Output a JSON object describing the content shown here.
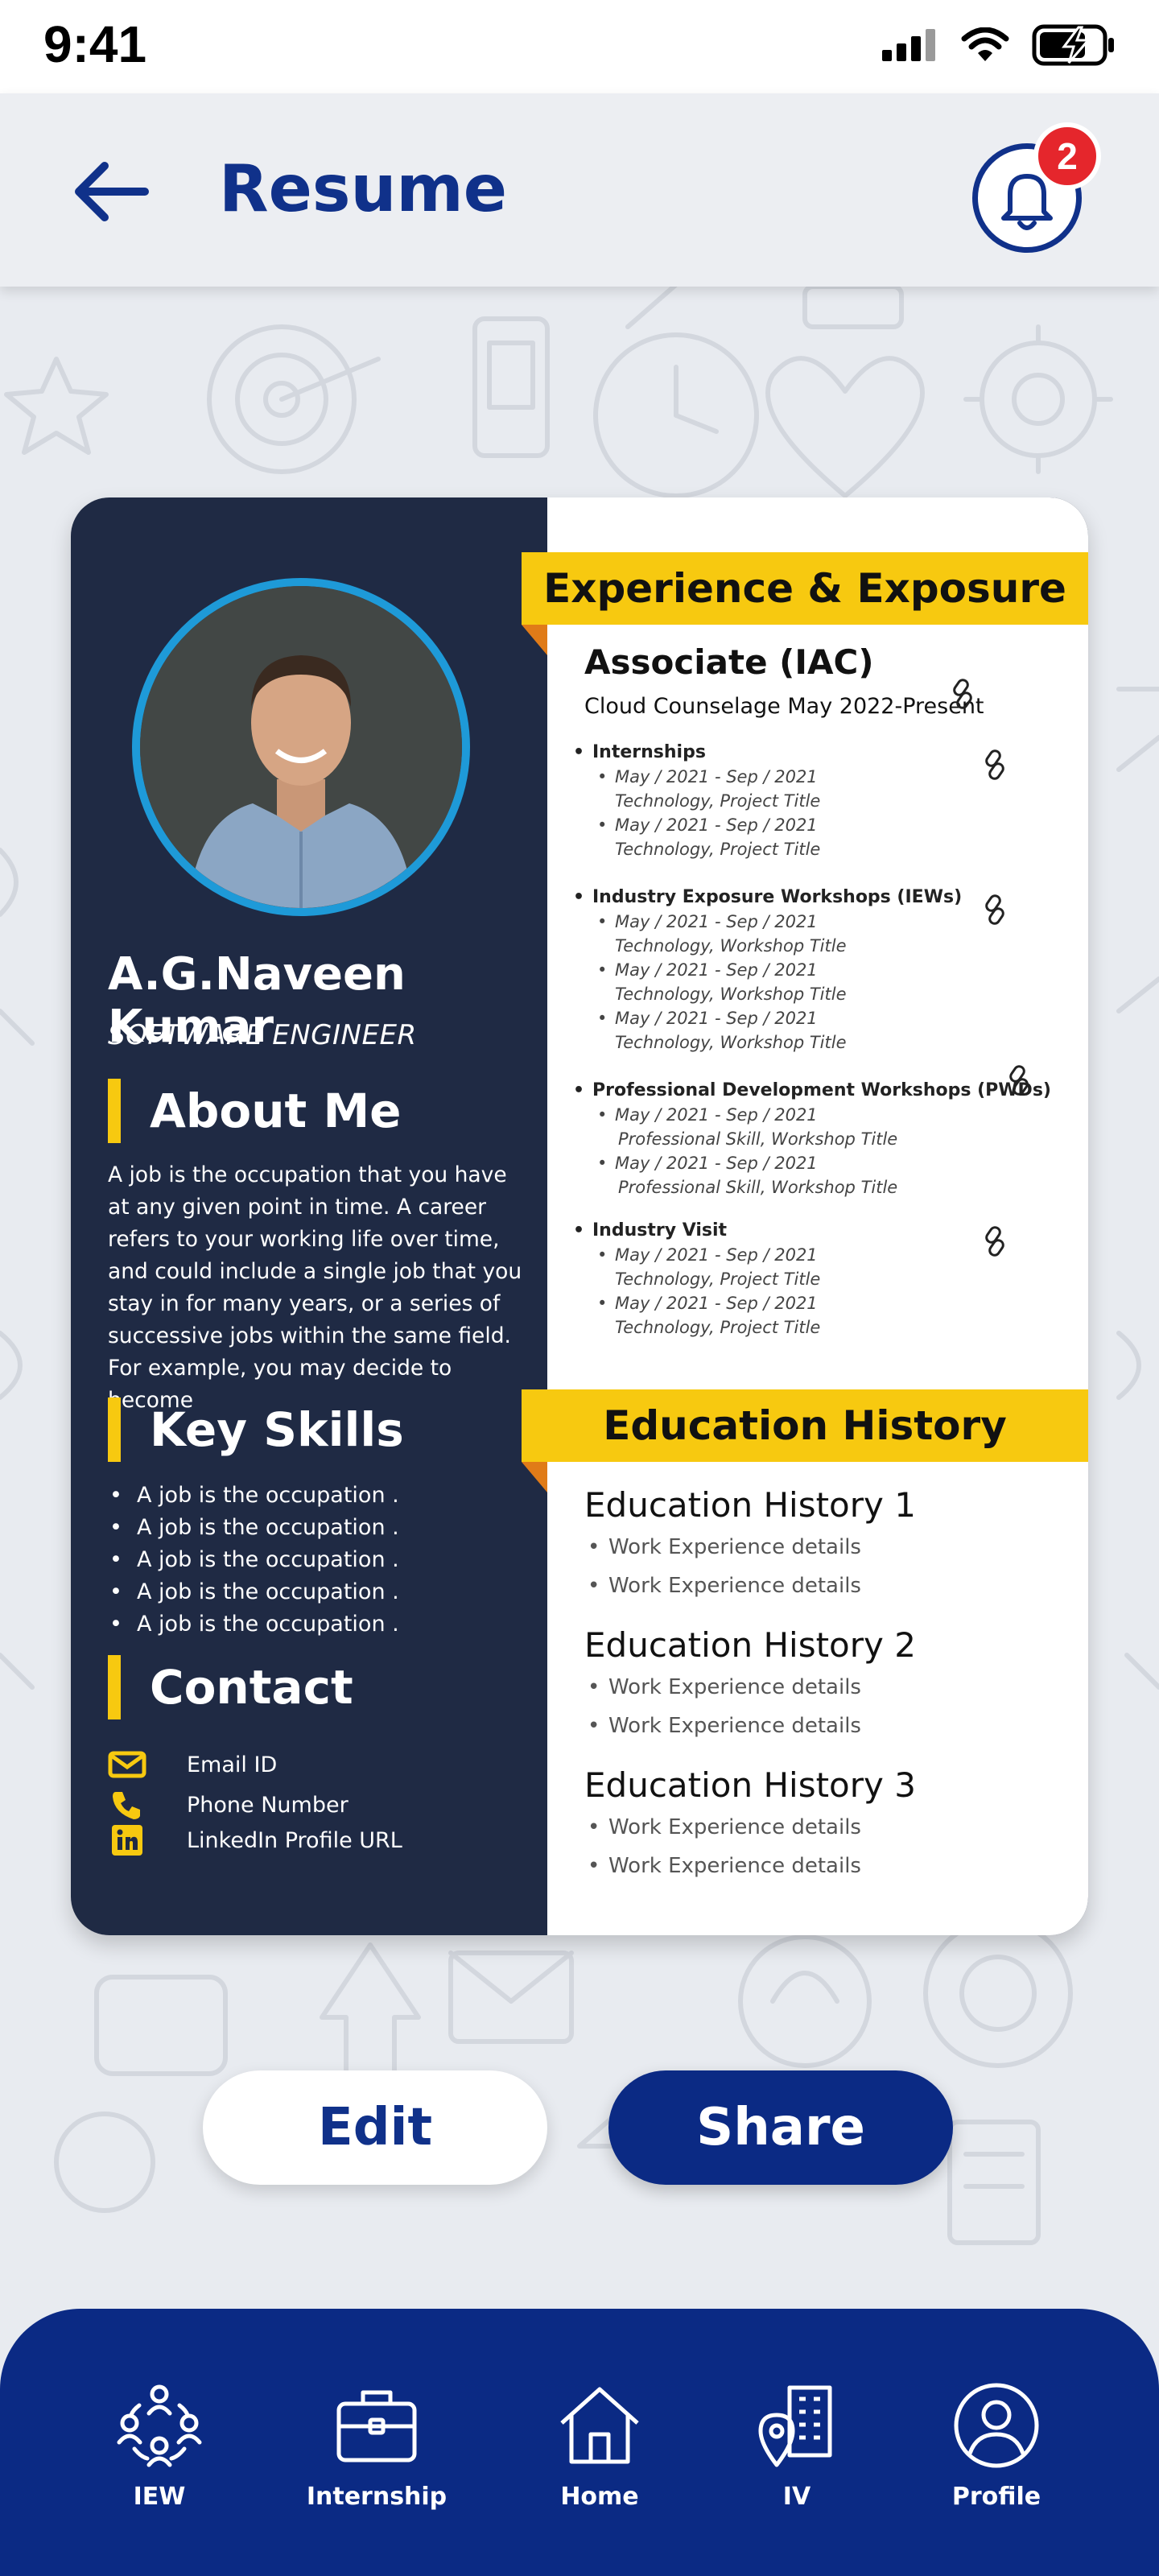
{
  "status_bar": {
    "time": "9:41"
  },
  "header": {
    "title": "Resume",
    "notification_count": "2"
  },
  "profile": {
    "name": "A.G.Naveen Kumar",
    "role": "SOFTWARE ENGINEER"
  },
  "about": {
    "title": "About Me",
    "text": "A job is the occupation that you have at any given point in time.  A career refers to your working life over time, and could include a single job that you stay in for many years, or a series of successive jobs within the same field.  For example, you may decide to become"
  },
  "skills": {
    "title": "Key Skills",
    "items": [
      "A job is the occupation .",
      "A job is the occupation .",
      "A job is the occupation .",
      "A job is the occupation .",
      "A job is the occupation ."
    ]
  },
  "contact": {
    "title": "Contact",
    "email": "Email ID",
    "phone": "Phone Number",
    "linkedin": "LinkedIn Profile URL"
  },
  "experience": {
    "title": "Experience & Exposure",
    "position": "Associate (IAC)",
    "company_line": "Cloud Counselage  May 2022-Present",
    "groups": [
      {
        "title": "Internships",
        "entries": [
          {
            "date": "May / 2021 - Sep / 2021",
            "detail": "Technology, Project Title"
          },
          {
            "date": "May / 2021 - Sep / 2021",
            "detail": "Technology, Project Title"
          }
        ]
      },
      {
        "title": "Industry Exposure Workshops (IEWs)",
        "entries": [
          {
            "date": "May / 2021 - Sep / 2021",
            "detail": "Technology, Workshop Title"
          },
          {
            "date": "May / 2021 - Sep / 2021",
            "detail": "Technology, Workshop Title"
          },
          {
            "date": "May / 2021 - Sep / 2021",
            "detail": "Technology, Workshop Title"
          }
        ]
      },
      {
        "title": "Professional Development Workshops (PWDs)",
        "entries": [
          {
            "date": "May / 2021 - Sep / 2021",
            "detail": "Professional Skill, Workshop Title"
          },
          {
            "date": "May / 2021 - Sep / 2021",
            "detail": "Professional Skill, Workshop Title"
          }
        ]
      },
      {
        "title": "Industry Visit",
        "entries": [
          {
            "date": "May / 2021 - Sep / 2021",
            "detail": "Technology, Project Title"
          },
          {
            "date": "May / 2021 - Sep / 2021",
            "detail": "Technology, Project Title"
          }
        ]
      }
    ]
  },
  "education": {
    "title": "Education History",
    "blocks": [
      {
        "title": "Education History 1",
        "items": [
          "Work Experience details",
          "Work Experience details"
        ]
      },
      {
        "title": "Education History 2",
        "items": [
          "Work Experience details",
          "Work Experience details"
        ]
      },
      {
        "title": "Education History 3",
        "items": [
          "Work Experience details",
          "Work Experience details"
        ]
      }
    ]
  },
  "actions": {
    "edit_label": "Edit",
    "share_label": "Share"
  },
  "nav": {
    "items": [
      {
        "label": "IEW",
        "icon": "team-icon"
      },
      {
        "label": "Internship",
        "icon": "briefcase-icon"
      },
      {
        "label": "Home",
        "icon": "home-icon"
      },
      {
        "label": "IV",
        "icon": "building-pin-icon"
      },
      {
        "label": "Profile",
        "icon": "profile-icon"
      }
    ]
  },
  "colors": {
    "brand": "#0b2a84",
    "accent": "#f7c910",
    "card_dark": "#1f2a44",
    "badge": "#e5262c",
    "photo_ring": "#1e9ad8"
  }
}
